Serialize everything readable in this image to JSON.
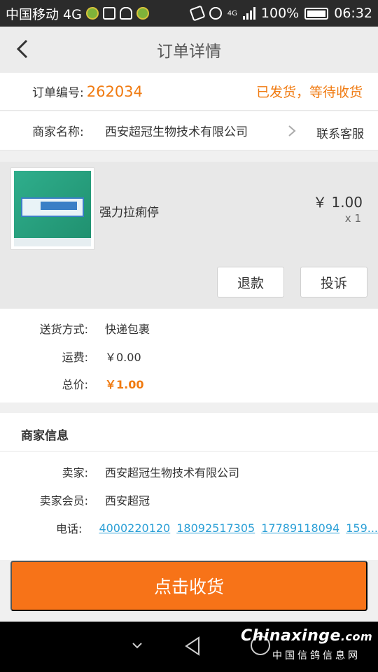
{
  "status_bar": {
    "carrier": "中国移动 4G",
    "battery": "100%",
    "time": "06:32",
    "net": "4G"
  },
  "header": {
    "title": "订单详情"
  },
  "order": {
    "number_label": "订单编号:",
    "number": "262034",
    "status": "已发货，等待收货"
  },
  "merchant": {
    "label": "商家名称:",
    "name": "西安超冠生物技术有限公司",
    "service_label": "联系客服"
  },
  "product": {
    "name": "强力拉痢停",
    "price": "￥ 1.00",
    "qty": "x 1",
    "refund_label": "退款",
    "complain_label": "投诉"
  },
  "shipping": {
    "method_label": "送货方式:",
    "method": "快递包裹",
    "fee_label": "运费:",
    "fee": "￥0.00",
    "total_label": "总价:",
    "total": "￥1.00"
  },
  "seller": {
    "title": "商家信息",
    "seller_label": "卖家:",
    "seller_name": "西安超冠生物技术有限公司",
    "member_label": "卖家会员:",
    "member_name": "西安超冠",
    "phone_label": "电话:",
    "phones": [
      "4000220120",
      "18092517305",
      "17789118094",
      "159..."
    ]
  },
  "action": {
    "receive_label": "点击收货"
  },
  "watermark": {
    "brand": "Chinaxinge",
    "domain": ".com",
    "sub": "中国信鸽信息网"
  },
  "colors": {
    "accent": "#f77318",
    "link": "#2a9fd6"
  }
}
